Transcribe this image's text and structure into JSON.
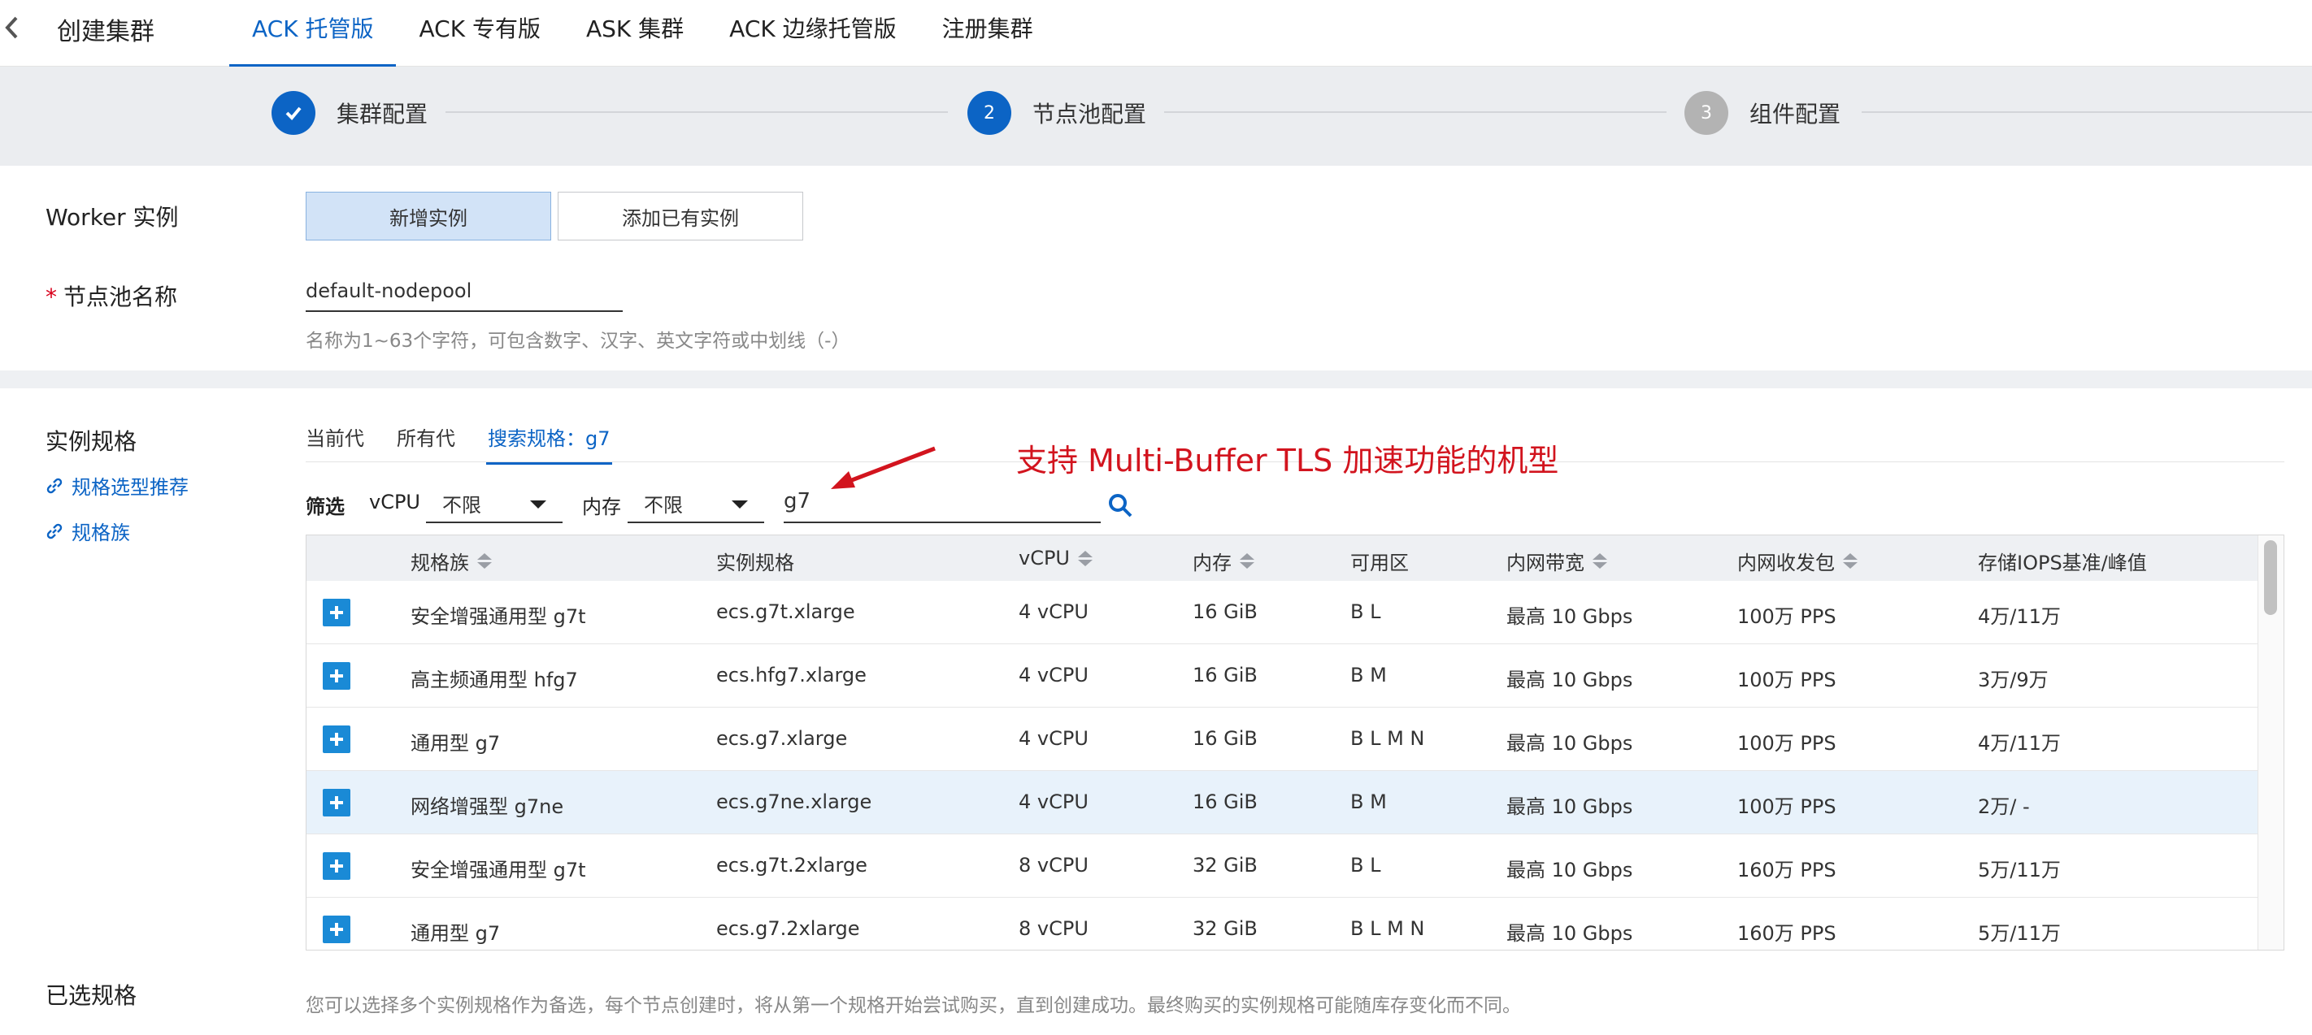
{
  "header": {
    "back_icon": "chevron-left-icon",
    "title": "创建集群",
    "tabs": [
      {
        "label": "ACK 托管版",
        "active": true
      },
      {
        "label": "ACK 专有版",
        "active": false
      },
      {
        "label": "ASK 集群",
        "active": false
      },
      {
        "label": "ACK 边缘托管版",
        "active": false
      },
      {
        "label": "注册集群",
        "active": false
      }
    ]
  },
  "steps": [
    {
      "number": "✓",
      "label": "集群配置",
      "status": "done"
    },
    {
      "number": "2",
      "label": "节点池配置",
      "status": "current"
    },
    {
      "number": "3",
      "label": "组件配置",
      "status": "todo"
    }
  ],
  "form": {
    "worker_label": "Worker 实例",
    "worker_options": [
      "新增实例",
      "添加已有实例"
    ],
    "worker_selected": "新增实例",
    "nodepool_required_mark": "*",
    "nodepool_label": "节点池名称",
    "nodepool_value": "default-nodepool",
    "nodepool_hint": "名称为1~63个字符，可包含数字、汉字、英文字符或中划线（-）"
  },
  "instance": {
    "section_label": "实例规格",
    "links": [
      "规格选型推荐",
      "规格族"
    ],
    "subtabs": [
      "当前代",
      "所有代",
      "搜索规格：g7"
    ],
    "active_subtab": "搜索规格：g7",
    "filter_label": "筛选",
    "vcpu_label": "vCPU",
    "vcpu_value": "不限",
    "memory_label": "内存",
    "memory_value": "不限",
    "search_value": "g7",
    "annotation": "支持 Multi-Buffer TLS 加速功能的机型",
    "annotation_color": "#d2141e"
  },
  "table": {
    "columns": [
      "规格族",
      "实例规格",
      "vCPU",
      "内存",
      "可用区",
      "内网带宽",
      "内网收发包",
      "存储IOPS基准/峰值"
    ],
    "sortable": [
      true,
      false,
      true,
      true,
      false,
      true,
      true,
      false
    ],
    "rows": [
      {
        "family": "安全增强通用型 g7t",
        "spec": "ecs.g7t.xlarge",
        "vcpu": "4 vCPU",
        "mem": "16 GiB",
        "zone": "B L",
        "bw": "最高 10 Gbps",
        "pps": "100万 PPS",
        "iops": "4万/11万",
        "highlight": false
      },
      {
        "family": "高主频通用型 hfg7",
        "spec": "ecs.hfg7.xlarge",
        "vcpu": "4 vCPU",
        "mem": "16 GiB",
        "zone": "B M",
        "bw": "最高 10 Gbps",
        "pps": "100万 PPS",
        "iops": "3万/9万",
        "highlight": false
      },
      {
        "family": "通用型 g7",
        "spec": "ecs.g7.xlarge",
        "vcpu": "4 vCPU",
        "mem": "16 GiB",
        "zone": "B L M N",
        "bw": "最高 10 Gbps",
        "pps": "100万 PPS",
        "iops": "4万/11万",
        "highlight": false
      },
      {
        "family": "网络增强型 g7ne",
        "spec": "ecs.g7ne.xlarge",
        "vcpu": "4 vCPU",
        "mem": "16 GiB",
        "zone": "B M",
        "bw": "最高 10 Gbps",
        "pps": "100万 PPS",
        "iops": "2万/ -",
        "highlight": true
      },
      {
        "family": "安全增强通用型 g7t",
        "spec": "ecs.g7t.2xlarge",
        "vcpu": "8 vCPU",
        "mem": "32 GiB",
        "zone": "B L",
        "bw": "最高 10 Gbps",
        "pps": "160万 PPS",
        "iops": "5万/11万",
        "highlight": false
      },
      {
        "family": "通用型 g7",
        "spec": "ecs.g7.2xlarge",
        "vcpu": "8 vCPU",
        "mem": "32 GiB",
        "zone": "B L M N",
        "bw": "最高 10 Gbps",
        "pps": "160万 PPS",
        "iops": "5万/11万",
        "highlight": false
      }
    ]
  },
  "selected": {
    "label": "已选规格",
    "note": "您可以选择多个实例规格作为备选，每个节点创建时，将从第一个规格开始尝试购买，直到创建成功。最终购买的实例规格可能随库存变化而不同。"
  },
  "colors": {
    "primary": "#0c64c5",
    "add_button": "#1a8ad6",
    "highlight_row": "#e8f2fb"
  }
}
